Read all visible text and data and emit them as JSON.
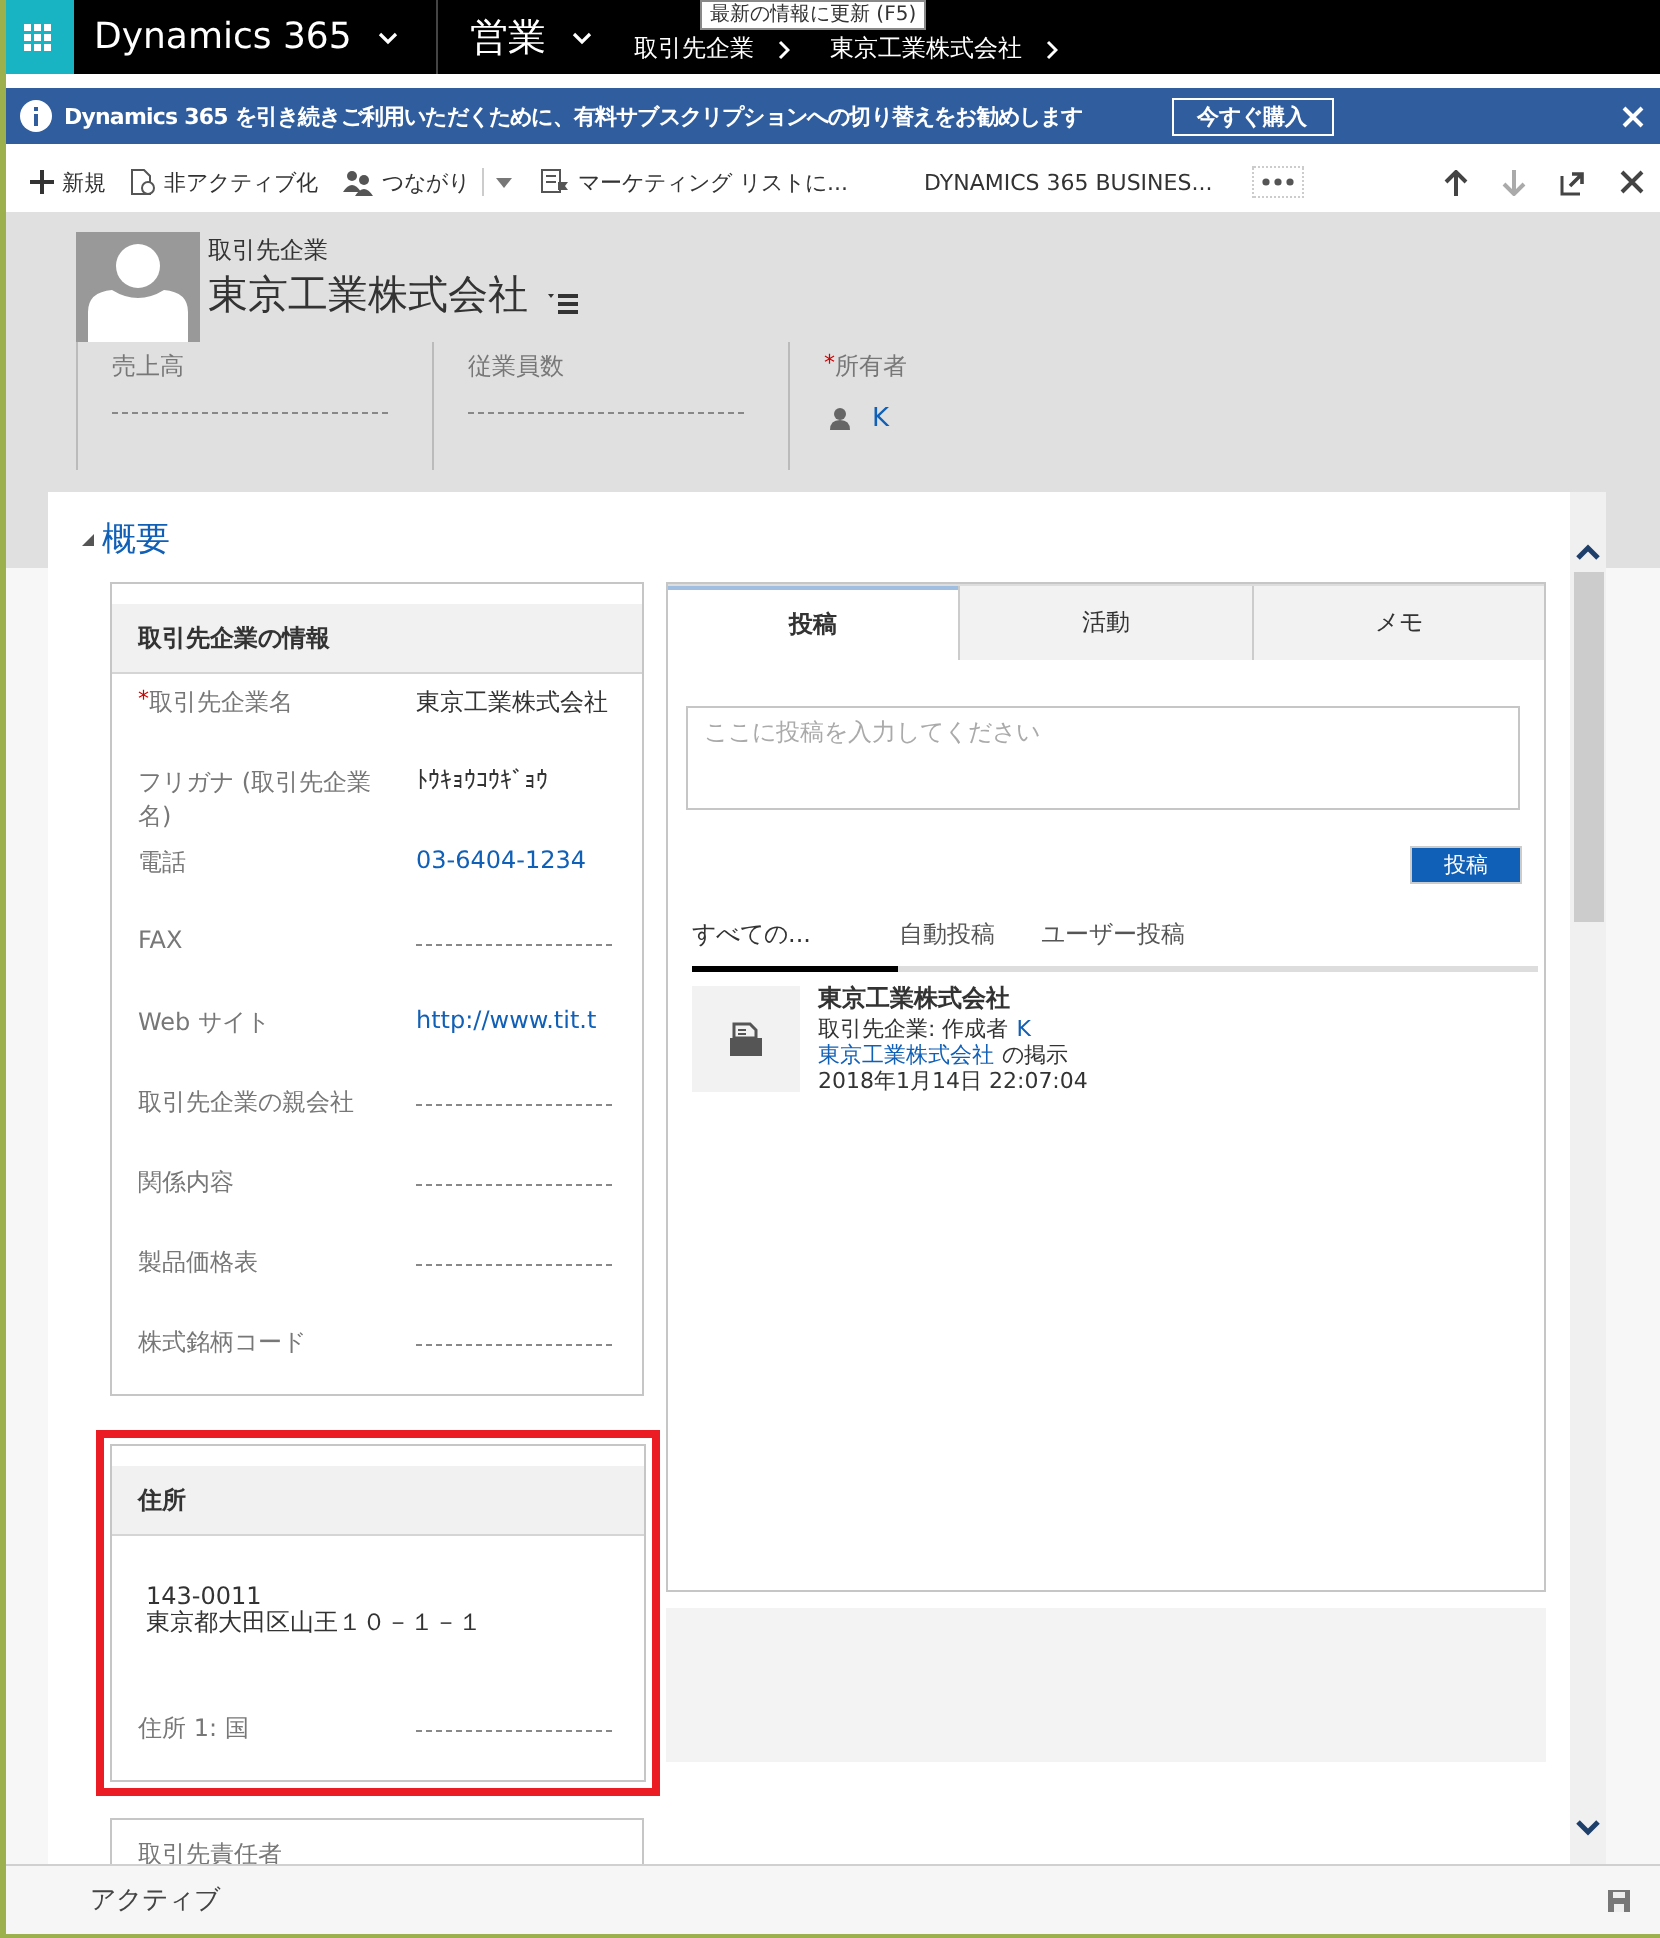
{
  "app_bar": {
    "app_name": "Dynamics 365",
    "area": "営業",
    "breadcrumb": [
      "取引先企業",
      "東京工業株式会社"
    ],
    "tooltip": "最新の情報に更新 (F5)"
  },
  "notification": {
    "text": "Dynamics 365 を引き続きご利用いただくために、有料サブスクリプションへの切り替えをお勧めします",
    "button": "今すぐ購入"
  },
  "commands": [
    {
      "kind": "new",
      "label": "新規",
      "split": false
    },
    {
      "kind": "deactivate",
      "label": "非アクティブ化",
      "split": false
    },
    {
      "kind": "connect",
      "label": "つながり",
      "split": true
    },
    {
      "kind": "marketing",
      "label": "マーケティング リストに...",
      "split": false
    },
    {
      "kind": "plain",
      "label": "DYNAMICS 365 BUSINES...",
      "split": false
    }
  ],
  "nav_buttons": [
    {
      "kind": "up",
      "disabled": false
    },
    {
      "kind": "down",
      "disabled": true
    },
    {
      "kind": "popout",
      "disabled": false
    },
    {
      "kind": "close",
      "disabled": false
    }
  ],
  "header": {
    "entity": "取引先企業",
    "title": "東京工業株式会社",
    "fields": [
      {
        "label": "売上高"
      },
      {
        "label": "従業員数"
      },
      {
        "label": "所有者",
        "marker": "*",
        "value": "K"
      }
    ]
  },
  "section": {
    "title": "概要",
    "expanded": true
  },
  "account_info": {
    "title": "取引先企業の情報",
    "fields": [
      {
        "label": "取引先企業名",
        "marker": "*",
        "kind": "text",
        "value": "東京工業株式会社"
      },
      {
        "label": "フリガナ (取引先企業名)",
        "kind": "text",
        "value": "ﾄｳｷｮｳｺｳｷﾞｮｳ"
      },
      {
        "label": "電話",
        "kind": "link",
        "value": "03-6404-1234"
      },
      {
        "label": "FAX",
        "kind": "empty"
      },
      {
        "label": "Web サイト",
        "kind": "link",
        "value": "http://www.tit.t"
      },
      {
        "label": "取引先企業の親会社",
        "kind": "empty"
      },
      {
        "label": "関係内容",
        "kind": "empty"
      },
      {
        "label": "製品価格表",
        "kind": "empty"
      },
      {
        "label": "株式銘柄コード",
        "kind": "empty"
      }
    ]
  },
  "address": {
    "title": "住所",
    "highlighted": true,
    "lines": [
      "143-0011",
      "東京都大田区山王１０－１－１"
    ],
    "fields": [
      {
        "label": "住所 1: 国",
        "kind": "empty"
      }
    ]
  },
  "contacts": {
    "title": "取引先責任者"
  },
  "social": {
    "tabs": [
      {
        "label": "投稿",
        "selected": true
      },
      {
        "label": "活動",
        "selected": false
      },
      {
        "label": "メモ",
        "selected": false
      }
    ],
    "placeholder": "ここに投稿を入力してください",
    "post_button": "投稿",
    "filters": [
      {
        "label": "すべての...",
        "selected": true
      },
      {
        "label": "自動投稿",
        "selected": false
      },
      {
        "label": "ユーザー投稿",
        "selected": false
      }
    ],
    "posts": [
      {
        "title": "東京工業株式会社",
        "byline": "取引先企業: 作成者",
        "author": "K",
        "link": "東京工業株式会社",
        "link_suffix": "の掲示",
        "time": "2018年1月14日 22:07:04"
      }
    ]
  },
  "status_bar": {
    "status": "アクティブ"
  }
}
